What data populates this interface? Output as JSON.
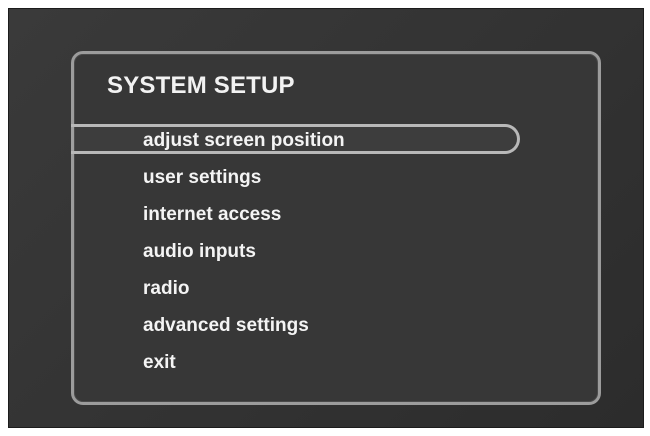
{
  "panel": {
    "title": "SYSTEM SETUP"
  },
  "menu": {
    "selected_index": 0,
    "items": [
      {
        "label": "adjust screen position"
      },
      {
        "label": "user settings"
      },
      {
        "label": "internet access"
      },
      {
        "label": "audio inputs"
      },
      {
        "label": "radio"
      },
      {
        "label": "advanced settings"
      },
      {
        "label": "exit"
      }
    ]
  },
  "colors": {
    "background": "#333333",
    "panel_border": "#9c9c9c",
    "highlight_border": "#b8b8b8",
    "text": "#f4f4f4"
  }
}
